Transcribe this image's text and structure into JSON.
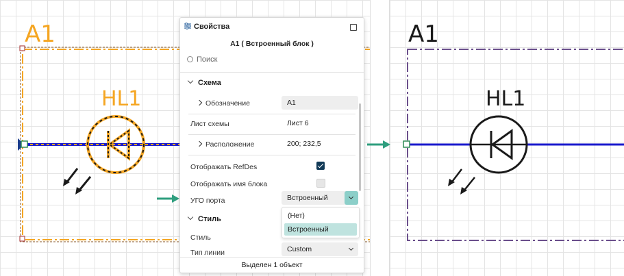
{
  "left_canvas": {
    "block_label": "A1",
    "component_label": "HL1",
    "colors": {
      "block": "#f5a623",
      "selection_dash": "#1a1a1a",
      "wire": "#1a1acc",
      "port": "#1a3c8c"
    }
  },
  "right_canvas": {
    "block_label": "A1",
    "component_label": "HL1",
    "colors": {
      "block_border": "#6b4f8c",
      "wire": "#1a1acc",
      "port": "#2e8b57"
    }
  },
  "panel": {
    "title": "Свойства",
    "title_icon": "sliders-icon",
    "subtitle": "A1 ( Встроенный блок )",
    "search_placeholder": "Поиск",
    "sections": {
      "schema": {
        "label": "Схема",
        "rows": {
          "designation": {
            "label": "Обозначение",
            "value": "A1"
          },
          "sheet": {
            "label": "Лист схемы",
            "value": "Лист 6"
          },
          "location": {
            "label": "Расположение",
            "value": "200; 232,5"
          },
          "show_refdes": {
            "label": "Отображать RefDes",
            "checked": true
          },
          "show_block_name": {
            "label": "Отображать имя блока",
            "checked": false
          },
          "port_ugo": {
            "label": "УГО порта",
            "value": "Встроенный"
          }
        },
        "port_ugo_options": [
          "(Нет)",
          "Встроенный"
        ]
      },
      "style": {
        "label": "Стиль",
        "rows": {
          "style": {
            "label": "Стиль"
          },
          "line_type": {
            "label": "Тип линии",
            "value": "Custom"
          }
        }
      }
    },
    "footer": "Выделен 1 объект"
  },
  "annotation_color": "#2e9e7e"
}
